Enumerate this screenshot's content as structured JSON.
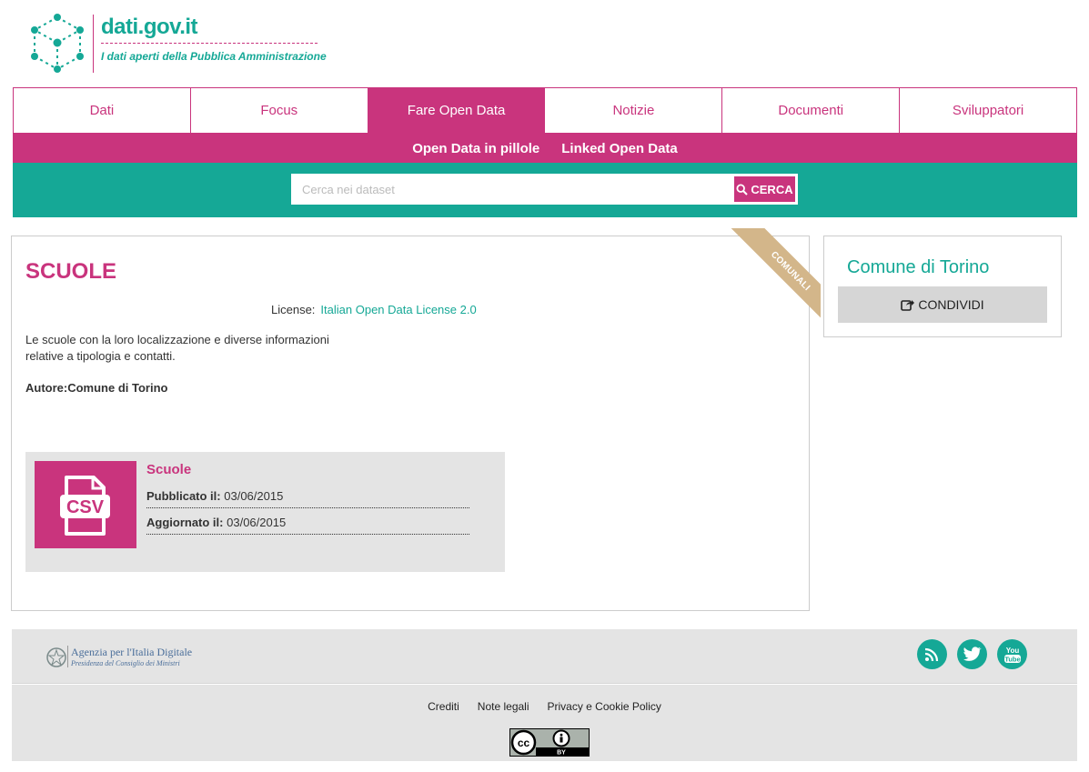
{
  "header": {
    "brand": "dati.gov.it",
    "tagline": "I dati aperti della Pubblica Amministrazione"
  },
  "nav": {
    "tabs": [
      {
        "label": "Dati",
        "active": false
      },
      {
        "label": "Focus",
        "active": false
      },
      {
        "label": "Fare Open Data",
        "active": true
      },
      {
        "label": "Notizie",
        "active": false
      },
      {
        "label": "Documenti",
        "active": false
      },
      {
        "label": "Sviluppatori",
        "active": false
      }
    ],
    "subnav": [
      "Open Data in pillole",
      "Linked Open Data"
    ]
  },
  "search": {
    "placeholder": "Cerca nei dataset",
    "value": "",
    "button_label": "CERCA",
    "button_icon": "search-icon"
  },
  "dataset": {
    "title": "SCUOLE",
    "ribbon": "COMUNALI",
    "license_label": "License:",
    "license_value": "Italian Open Data License 2.0",
    "description": "Le scuole con la loro localizzazione e diverse informazioni relative a tipologia e contatti.",
    "author": "Autore:Comune di Torino",
    "resource": {
      "format": "CSV",
      "name": "Scuole",
      "published_label": "Pubblicato il:",
      "published_value": "03/06/2015",
      "updated_label": "Aggiornato il:",
      "updated_value": "03/06/2015"
    }
  },
  "sidebar": {
    "organization": "Comune di Torino",
    "share_label": "CONDIVIDI",
    "share_icon": "share-icon"
  },
  "footer": {
    "agency_line1": "Agenzia per l'Italia Digitale",
    "agency_line2": "Presidenza del Consiglio dei Ministri",
    "links": [
      "Crediti",
      "Note legali",
      "Privacy e Cookie Policy"
    ],
    "social": [
      "rss-icon",
      "twitter-icon",
      "youtube-icon"
    ],
    "license_badge_text": "BY"
  },
  "colors": {
    "magenta": "#c9347d",
    "teal": "#15a896",
    "ribbon": "#d3b68a",
    "footer_bg": "#e4e4e4"
  }
}
